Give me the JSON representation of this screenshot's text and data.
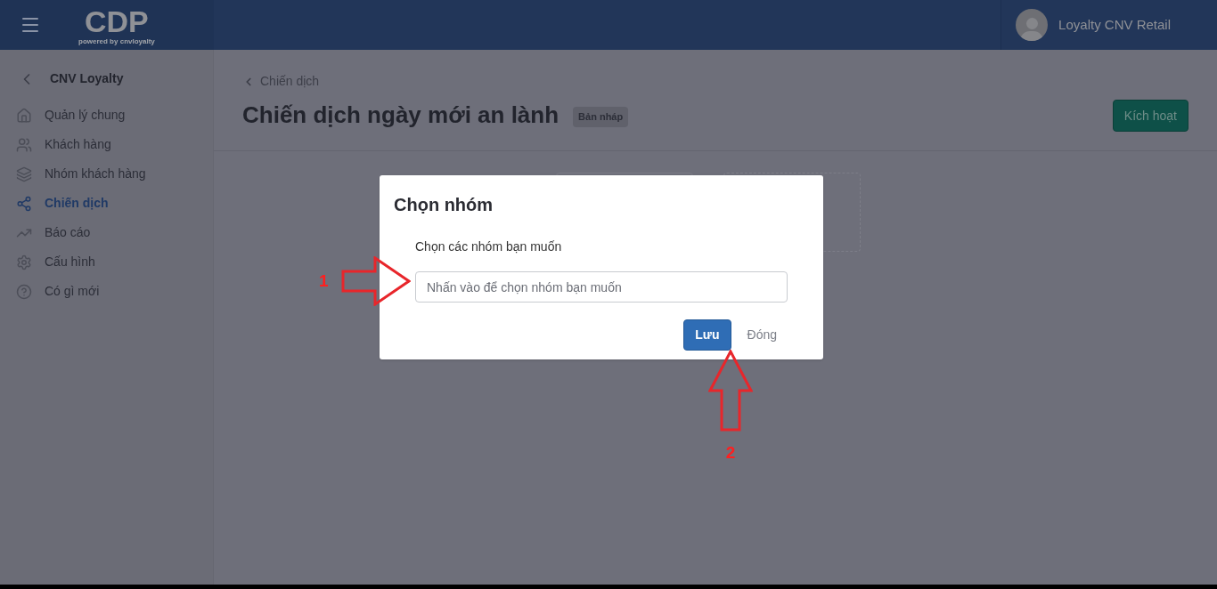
{
  "header": {
    "logo": "CDP",
    "logo_tagline": "powered by cnvloyalty",
    "user_name": "Loyalty CNV Retail"
  },
  "sidebar": {
    "title": "CNV Loyalty",
    "items": [
      {
        "label": "Quản lý chung",
        "selected": false
      },
      {
        "label": "Khách hàng",
        "selected": false
      },
      {
        "label": "Nhóm khách hàng",
        "selected": false
      },
      {
        "label": "Chiến dịch",
        "selected": true
      },
      {
        "label": "Báo cáo",
        "selected": false
      },
      {
        "label": "Cấu hình",
        "selected": false
      },
      {
        "label": "Có gì mới",
        "selected": false
      }
    ]
  },
  "page": {
    "breadcrumb": "Chiến dịch",
    "title": "Chiến dịch ngày mới an lành",
    "status_badge": "Bản nháp",
    "activate_button": "Kích hoạt"
  },
  "dialog": {
    "title": "Chọn nhóm",
    "field_label": "Chọn các nhóm bạn muốn",
    "field_placeholder": "Nhấn vào để chọn nhóm bạn muốn",
    "buttons": [
      {
        "label": "Lưu",
        "kind": "primary"
      },
      {
        "label": "Đóng",
        "kind": "link"
      }
    ]
  },
  "annotations": [
    {
      "label": "1",
      "kind": "right"
    },
    {
      "label": "2",
      "kind": "up"
    }
  ]
}
